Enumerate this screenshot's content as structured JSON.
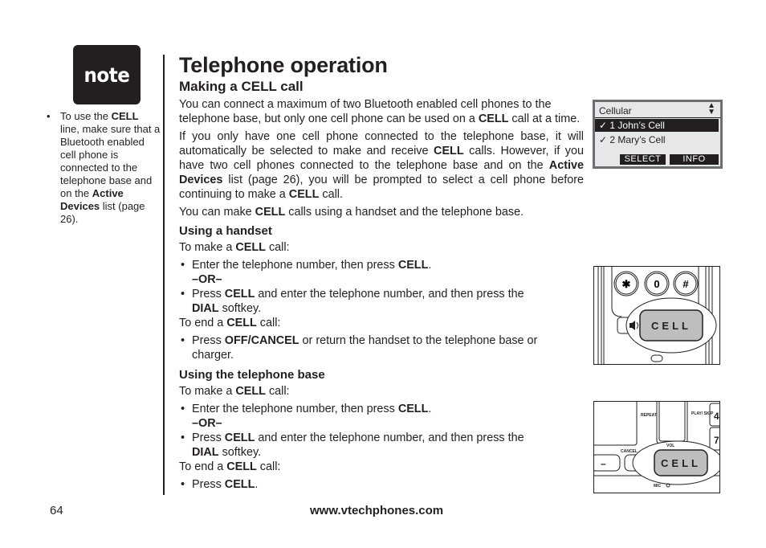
{
  "sidebar": {
    "note_badge": "note",
    "note_text_parts": [
      {
        "t": "To use the ",
        "b": false
      },
      {
        "t": "CELL",
        "b": true
      },
      {
        "t": " line, make sure that a Bluetooth enabled cell phone is connected to the telephone base and on the ",
        "b": false
      },
      {
        "t": "Active Devices",
        "b": true
      },
      {
        "t": " list (page 26).",
        "b": false
      }
    ]
  },
  "main": {
    "title": "Telephone operation",
    "section_title": "Making a CELL call",
    "paragraphs": [
      [
        {
          "t": "You can connect a maximum of two Bluetooth enabled cell phones to the telephone base, but only one cell phone can be used on a ",
          "b": false
        },
        {
          "t": "CELL",
          "b": true
        },
        {
          "t": " call at a time.",
          "b": false
        }
      ],
      [
        {
          "t": "If you only have one cell phone connected to the telephone base, it will automatically be selected to make and receive ",
          "b": false
        },
        {
          "t": "CELL",
          "b": true
        },
        {
          "t": " calls. However, if you have two cell phones connected to the telephone base and on the ",
          "b": false
        },
        {
          "t": "Active Devices",
          "b": true
        },
        {
          "t": " list (page 26), you will be prompted to select a cell phone before continuing to make a ",
          "b": false
        },
        {
          "t": "CELL",
          "b": true
        },
        {
          "t": " call.",
          "b": false
        }
      ],
      [
        {
          "t": "You can make ",
          "b": false
        },
        {
          "t": "CELL",
          "b": true
        },
        {
          "t": " calls using a handset and the telephone base.",
          "b": false
        }
      ]
    ],
    "handset": {
      "heading": "Using a handset",
      "make_intro": [
        {
          "t": "To make a ",
          "b": false
        },
        {
          "t": "CELL",
          "b": true
        },
        {
          "t": " call:",
          "b": false
        }
      ],
      "make_bullets": [
        [
          {
            "t": "Enter the telephone number, then press ",
            "b": false
          },
          {
            "t": "CELL",
            "b": true
          },
          {
            "t": ".",
            "b": false
          }
        ],
        [
          {
            "t": "Press ",
            "b": false
          },
          {
            "t": "CELL",
            "b": true
          },
          {
            "t": " and enter the telephone number, and then press the ",
            "b": false
          },
          {
            "t": "DIAL",
            "b": true
          },
          {
            "t": " softkey.",
            "b": false
          }
        ]
      ],
      "or_label": "–OR–",
      "end_intro": [
        {
          "t": "To end a ",
          "b": false
        },
        {
          "t": "CELL",
          "b": true
        },
        {
          "t": " call:",
          "b": false
        }
      ],
      "end_bullets": [
        [
          {
            "t": "Press ",
            "b": false
          },
          {
            "t": "OFF/CANCEL",
            "b": true
          },
          {
            "t": " or return the handset to the telephone base or charger.",
            "b": false
          }
        ]
      ]
    },
    "base": {
      "heading": "Using the telephone base",
      "make_intro": [
        {
          "t": "To make a ",
          "b": false
        },
        {
          "t": "CELL",
          "b": true
        },
        {
          "t": " call:",
          "b": false
        }
      ],
      "make_bullets": [
        [
          {
            "t": "Enter the telephone number, then press ",
            "b": false
          },
          {
            "t": "CELL",
            "b": true
          },
          {
            "t": ".",
            "b": false
          }
        ],
        [
          {
            "t": "Press ",
            "b": false
          },
          {
            "t": "CELL",
            "b": true
          },
          {
            "t": " and enter the telephone number, and then press the ",
            "b": false
          },
          {
            "t": "DIAL",
            "b": true
          },
          {
            "t": " softkey.",
            "b": false
          }
        ]
      ],
      "or_label": "–OR–",
      "end_intro": [
        {
          "t": "To end a ",
          "b": false
        },
        {
          "t": "CELL",
          "b": true
        },
        {
          "t": " call:",
          "b": false
        }
      ],
      "end_bullets": [
        [
          {
            "t": "Press ",
            "b": false
          },
          {
            "t": "CELL",
            "b": true
          },
          {
            "t": ".",
            "b": false
          }
        ]
      ]
    }
  },
  "lcd_screen": {
    "title": "Cellular",
    "scroll_icon": "up-down-arrows-icon",
    "rows": [
      {
        "check": "✓",
        "label": "1 John’s Cell",
        "selected": true
      },
      {
        "check": "✓",
        "label": "2 Mary’s Cell",
        "selected": false
      }
    ],
    "softkeys": [
      "SELECT",
      "INFO"
    ]
  },
  "handset_figure": {
    "keys": [
      "✱",
      "0",
      "#"
    ],
    "speaker_icon": "speakerphone-icon",
    "button_label": "CELL"
  },
  "base_figure": {
    "labels": {
      "repeat": "REPEAT",
      "play_skip": "PLAY/ SKIP",
      "cancel": "CANCEL",
      "vol": "VOL",
      "mic": "MIC"
    },
    "keys": [
      "4",
      "7",
      "–"
    ],
    "button_label": "CELL"
  },
  "footer": {
    "page_number": "64",
    "url": "www.vtechphones.com"
  }
}
